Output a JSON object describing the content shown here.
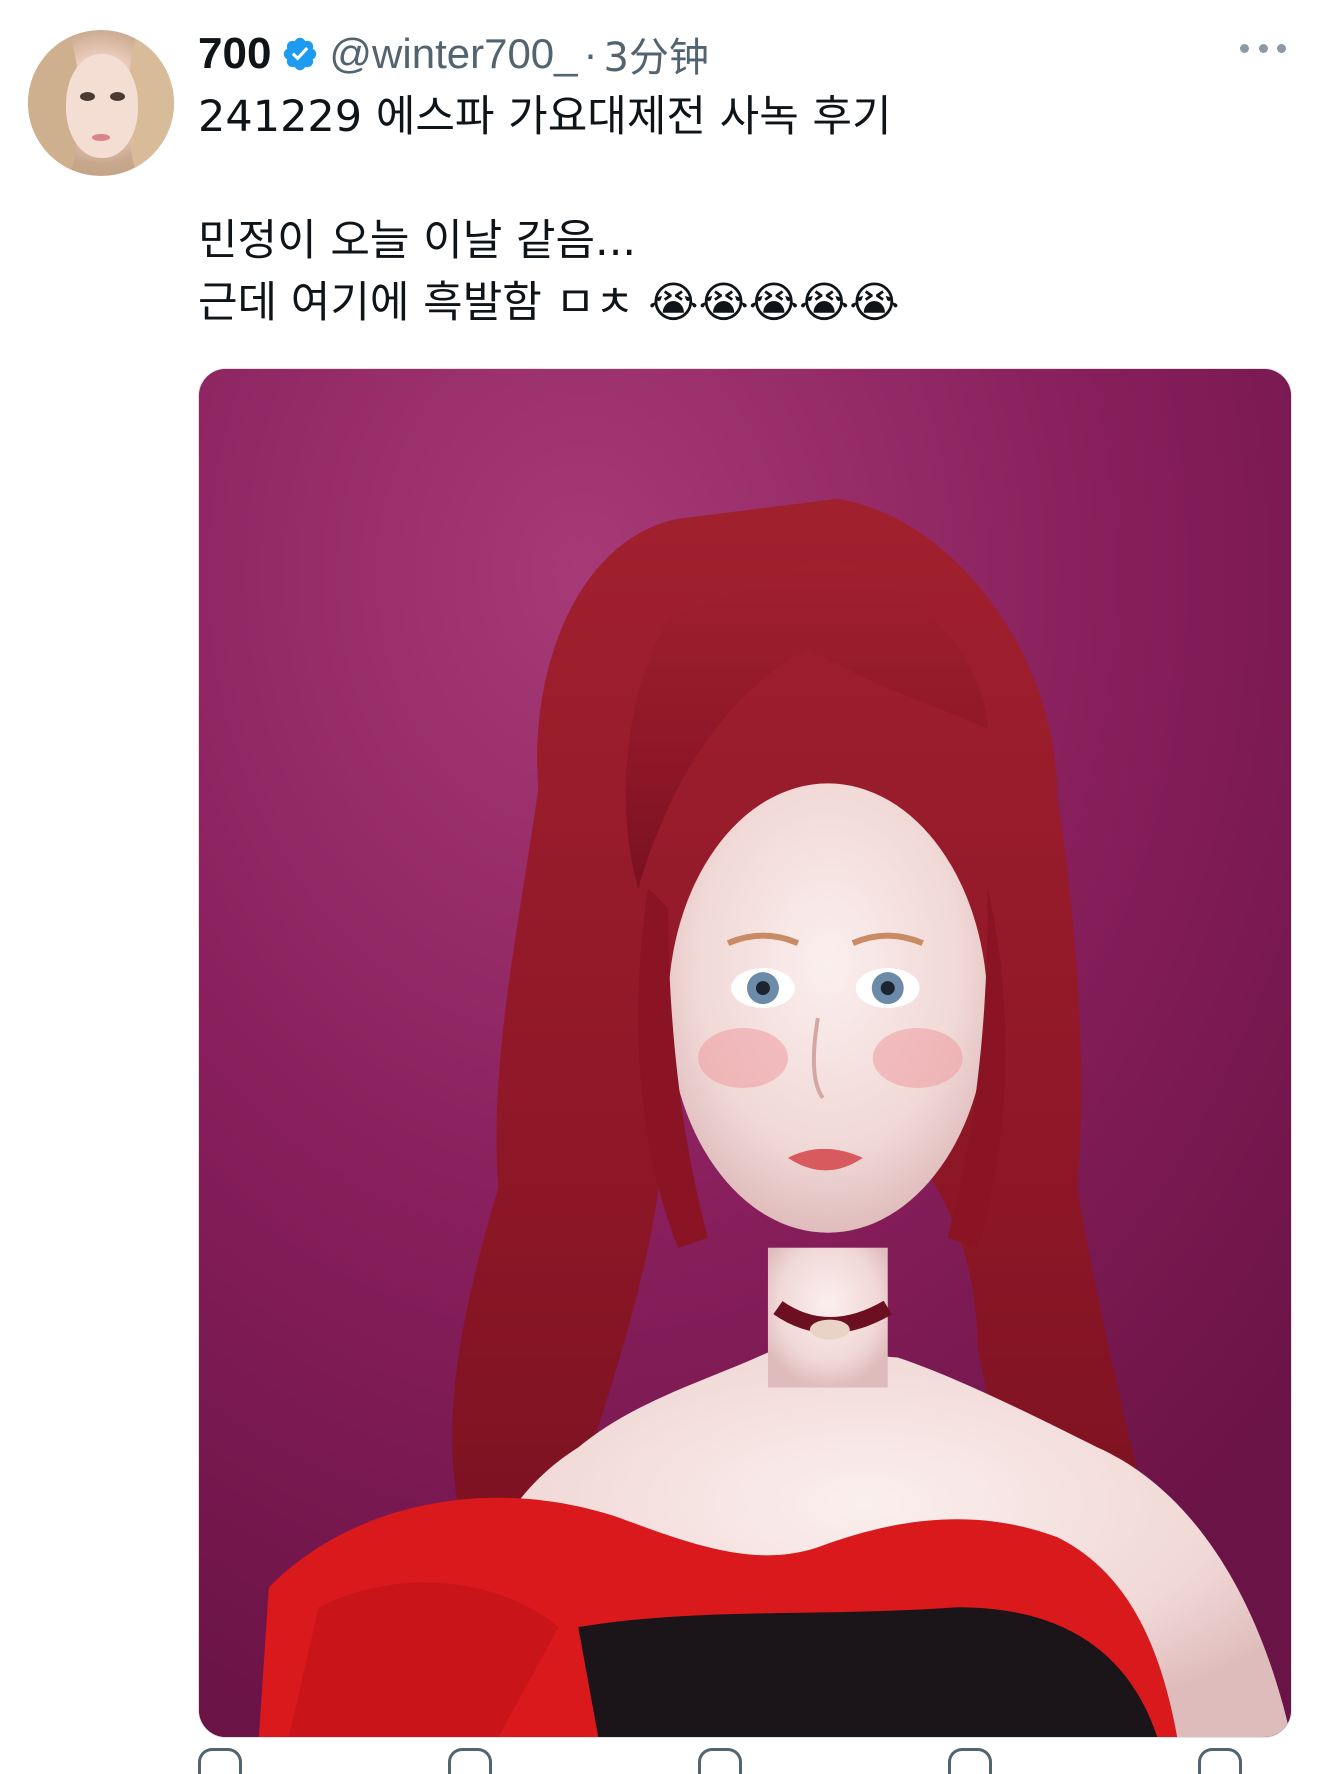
{
  "tweet": {
    "author": {
      "display_name": "700",
      "handle": "@winter700_",
      "verified": true,
      "verified_color": "#1d9bf0",
      "avatar_icon": "avatar"
    },
    "separator": "·",
    "timestamp": "3分钟",
    "text_lines": [
      "241229 에스파 가요대제전 사녹 후기",
      "",
      "민정이 오늘 이날 같음...",
      "근데 여기에 흑발함 ㅁㅊ 😭😭😭😭😭"
    ],
    "media": {
      "type": "photo",
      "background_color": "#8a1f5d"
    },
    "more_icon": "more-options-icon"
  },
  "colors": {
    "text_primary": "#0f1419",
    "text_secondary": "#536471",
    "accent": "#1d9bf0"
  }
}
